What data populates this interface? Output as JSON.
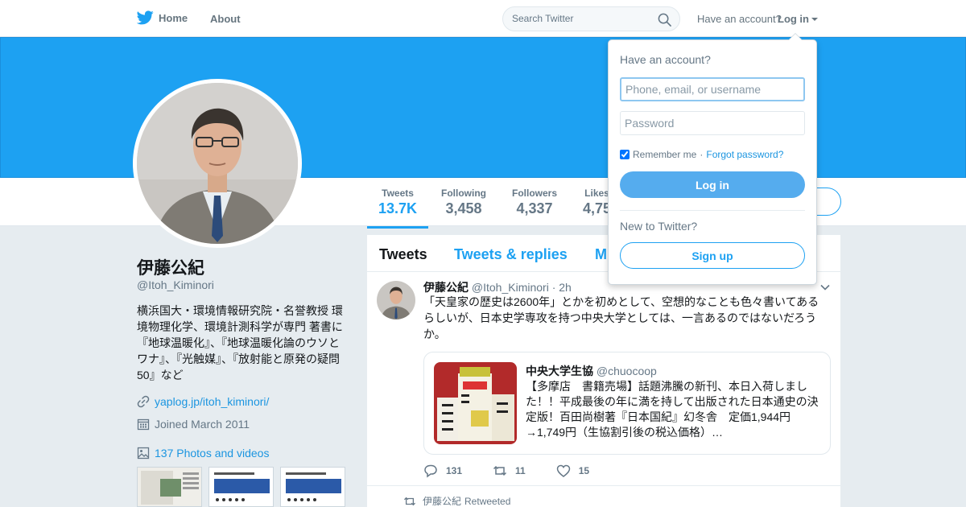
{
  "nav": {
    "home_label": "Home",
    "about_label": "About",
    "search_placeholder": "Search Twitter",
    "have_account": "Have an account?",
    "login_label": "Log in"
  },
  "stats": [
    {
      "label": "Tweets",
      "value": "13.7K"
    },
    {
      "label": "Following",
      "value": "3,458"
    },
    {
      "label": "Followers",
      "value": "4,337"
    },
    {
      "label": "Likes",
      "value": "4,75"
    }
  ],
  "profile": {
    "name": "伊藤公紀",
    "handle": "@Itoh_Kiminori",
    "bio": "横浜国大・環境情報研究院・名誉教授 環境物理化学、環境計測科学が専門 著書に『地球温暖化』、『地球温暖化論のウソとワナ』、『光触媒』、『放射能と原発の疑問50』など",
    "url": "yaplog.jp/itoh_kiminori/",
    "joined": "Joined March 2011",
    "photos_label": "137 Photos and videos"
  },
  "timeline": {
    "tabs": [
      "Tweets",
      "Tweets & replies",
      "M"
    ],
    "tweet": {
      "name": "伊藤公紀",
      "handle": "@Itoh_Kiminori",
      "time": "· 2h",
      "text": "「天皇家の歴史は2600年」とかを初めとして、空想的なことも色々書いてあるらしいが、日本史学専攻を持つ中央大学としては、一言あるのではないだろうか。",
      "quote": {
        "name": "中央大学生協",
        "handle": "@chuocoop",
        "text": "【多摩店　書籍売場】話題沸騰の新刊、本日入荷しました！！平成最後の年に満を持して出版された日本通史の決定版！百田尚樹著『日本国紀』幻冬舎　定価1,944円→1,749円（生協割引後の税込価格）…"
      },
      "replies": "131",
      "retweets": "11",
      "likes": "15"
    },
    "retweeted_by": "伊藤公紀",
    "retweeted_suffix": "Retweeted"
  },
  "login_dropdown": {
    "title": "Have an account?",
    "username_placeholder": "Phone, email, or username",
    "password_placeholder": "Password",
    "remember": "Remember me",
    "separator": "·",
    "forgot": "Forgot password?",
    "login_button": "Log in",
    "new_to": "New to Twitter?",
    "signup_button": "Sign up"
  },
  "colors": {
    "brand": "#1da1f2",
    "banner": "#1da1f2",
    "login_button": "#55acee"
  }
}
